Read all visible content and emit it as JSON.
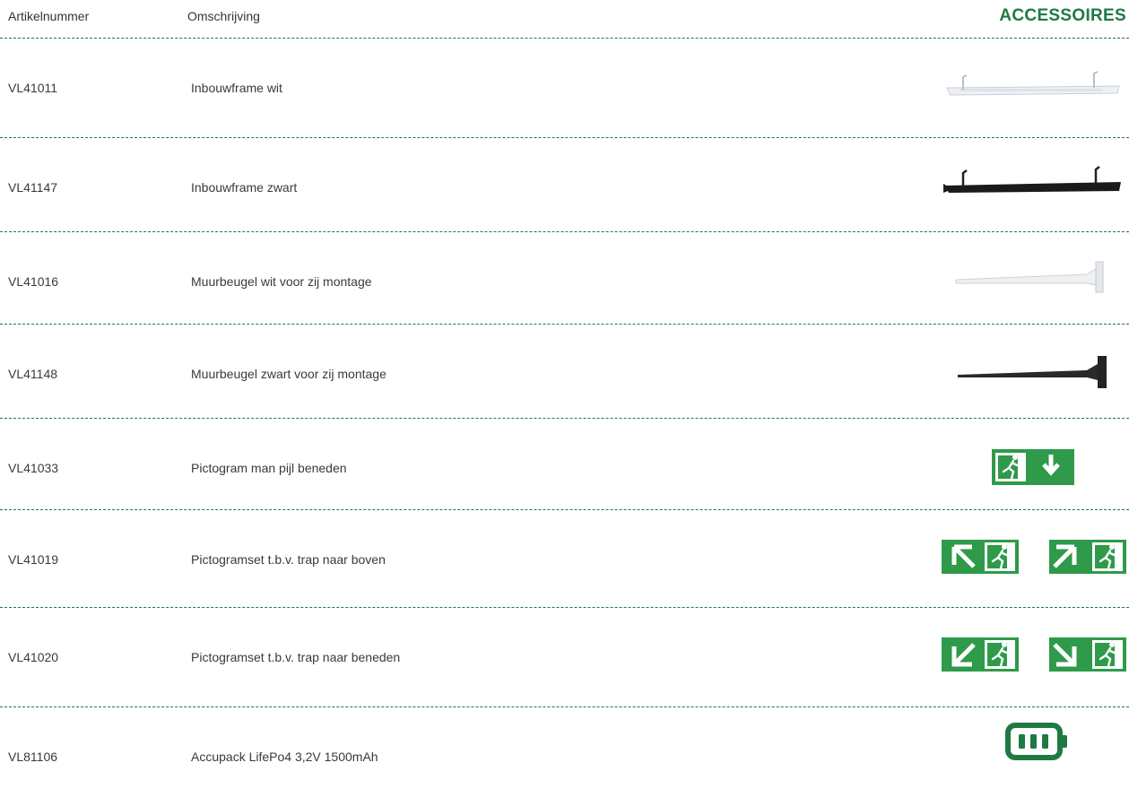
{
  "header": {
    "col_article": "Artikelnummer",
    "col_description": "Omschrijving",
    "section_title": "ACCESSOIRES"
  },
  "colors": {
    "accent": "#1e7a43",
    "sign_green": "#2e9a4a",
    "text": "#3a3a3a"
  },
  "rows": [
    {
      "code": "VL41011",
      "description": "Inbouwframe wit",
      "image": "white-recess-frame"
    },
    {
      "code": "VL41147",
      "description": "Inbouwframe zwart",
      "image": "black-recess-frame"
    },
    {
      "code": "VL41016",
      "description": "Muurbeugel wit voor zij montage",
      "image": "white-wall-bracket"
    },
    {
      "code": "VL41148",
      "description": "Muurbeugel zwart voor zij montage",
      "image": "black-wall-bracket"
    },
    {
      "code": "VL41033",
      "description": "Pictogram man pijl beneden",
      "image": "exit-sign-man-arrow-down"
    },
    {
      "code": "VL41019",
      "description": "Pictogramset t.b.v. trap naar boven",
      "image": "exit-sign-set-stairs-up"
    },
    {
      "code": "VL41020",
      "description": "Pictogramset t.b.v. trap naar beneden",
      "image": "exit-sign-set-stairs-down"
    },
    {
      "code": "VL81106",
      "description": "Accupack LifePo4 3,2V 1500mAh",
      "image": "battery-icon"
    }
  ]
}
